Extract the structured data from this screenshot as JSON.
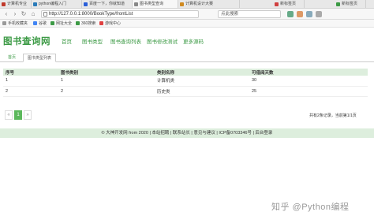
{
  "browser": {
    "tabs": [
      {
        "label": "计算机专业",
        "active": false,
        "color": "#c0392b"
      },
      {
        "label": "python编程入门",
        "active": false,
        "color": "#2b7bb9"
      },
      {
        "label": "百度一下，你就知道",
        "active": false,
        "color": "#2b5fd9"
      },
      {
        "label": "图书类型查询",
        "active": true,
        "color": "#888888"
      },
      {
        "label": "计算机设计大赛",
        "active": false,
        "color": "#d08a20"
      },
      {
        "label": "新标签页",
        "active": false,
        "color": "#d04040"
      },
      {
        "label": "新标签页",
        "active": false,
        "color": "#3c9a45"
      }
    ],
    "url": "http://127.0.0.1:8000/BookType/frontList",
    "search_placeholder": "点此搜索",
    "bookmarks": [
      {
        "label": "手机收藏夹",
        "color": "#999999"
      },
      {
        "label": "谷歌",
        "color": "#4285f4"
      },
      {
        "label": "网址大全",
        "color": "#3c9a45"
      },
      {
        "label": "360搜索",
        "color": "#3c9a45"
      },
      {
        "label": "游戏中心",
        "color": "#e04040"
      }
    ]
  },
  "site": {
    "logo": "图书查询网",
    "menu": [
      "首页",
      "图书类型",
      "图书查询列表",
      "图书修改测试",
      "更多源码"
    ],
    "tabs": [
      "首页",
      "图书类型列表"
    ]
  },
  "table": {
    "headers": [
      "序号",
      "图书类别",
      "类别名称",
      "可借阅天数"
    ],
    "rows": [
      [
        "1",
        "1",
        "计算机类",
        "30"
      ],
      [
        "2",
        "2",
        "历史类",
        "25"
      ]
    ]
  },
  "pager": {
    "prev": "«",
    "current": "1",
    "next": "»",
    "info": "共有2条记录，当前第1/1页"
  },
  "footer": "© 大神开发网 from 2020 | 本站招聘 | 联系站长 | 意见与建议 | ICP备0703346号 | 后台登录",
  "watermark": "知乎 @Python编程"
}
